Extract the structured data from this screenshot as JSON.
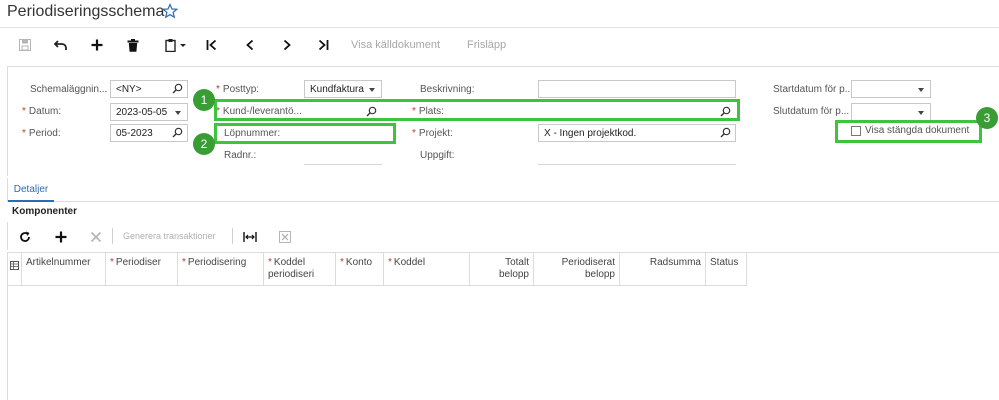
{
  "header": {
    "title": "Periodiseringsschema"
  },
  "toolbar": {
    "source_doc": "Visa källdokument",
    "release": "Frisläpp"
  },
  "form": {
    "schedule": {
      "label": "Schemaläggnin...",
      "value": "<NY>"
    },
    "date": {
      "label": "Datum:",
      "value": "2023-05-05"
    },
    "period": {
      "label": "Period:",
      "value": "05-2023"
    },
    "post_type": {
      "label": "Posttyp:",
      "value": "Kundfaktura"
    },
    "customer": {
      "label": "Kund-/leverantö...",
      "value": ""
    },
    "run_number": {
      "label": "Löpnummer:",
      "value": ""
    },
    "line_number": {
      "label": "Radnr.:",
      "value": ""
    },
    "description": {
      "label": "Beskrivning:",
      "value": ""
    },
    "location": {
      "label": "Plats:",
      "value": ""
    },
    "project": {
      "label": "Projekt:",
      "value": "X - Ingen projektkod."
    },
    "task": {
      "label": "Uppgift:",
      "value": ""
    },
    "start_date": {
      "label": "Startdatum för p...",
      "value": ""
    },
    "end_date": {
      "label": "Slutdatum för p...",
      "value": ""
    },
    "show_closed": {
      "label": "Visa stängda dokument",
      "checked": false
    }
  },
  "callouts": [
    "1",
    "2",
    "3"
  ],
  "tabs": [
    {
      "label": "Detaljer",
      "active": true
    }
  ],
  "components": {
    "title": "Komponenter",
    "generate_label": "Generera transaktioner",
    "columns": [
      {
        "label": "Artikelnummer",
        "required": false
      },
      {
        "label": "Periodiser",
        "required": true
      },
      {
        "label": "Periodisering",
        "required": true
      },
      {
        "label": "Koddel periodiseri",
        "required": true
      },
      {
        "label": "Konto",
        "required": true
      },
      {
        "label": "Koddel",
        "required": true
      },
      {
        "label": "Totalt belopp",
        "required": false
      },
      {
        "label": "Periodiserat belopp",
        "required": false
      },
      {
        "label": "Radsumma",
        "required": false
      },
      {
        "label": "Status",
        "required": false
      }
    ]
  },
  "colors": {
    "highlight": "#3dc43d",
    "badge": "#3a9d34",
    "link": "#2b6bb3",
    "required": "#c0392b"
  }
}
